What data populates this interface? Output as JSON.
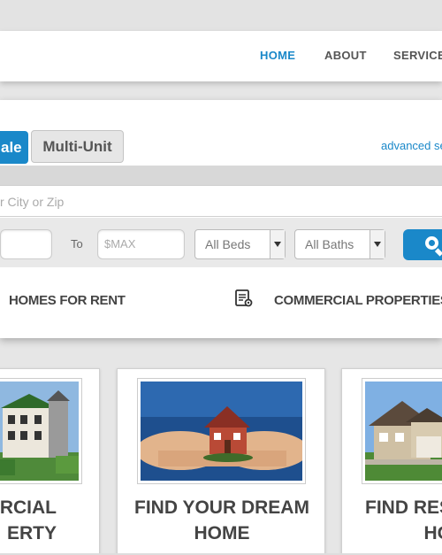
{
  "nav": {
    "items": [
      {
        "label": "HOME",
        "active": true
      },
      {
        "label": "ABOUT",
        "active": false
      },
      {
        "label": "SERVICES",
        "active": false
      }
    ]
  },
  "search": {
    "tabs": [
      {
        "label": "ale",
        "active": true
      },
      {
        "label": "Multi-Unit",
        "active": false
      }
    ],
    "advanced_link": "advanced se",
    "location_placeholder": "r City or Zip",
    "price_min_value": "",
    "to_label": "To",
    "price_max_placeholder": "$MAX",
    "beds_selected": "All Beds",
    "baths_selected": "All Baths",
    "search_button_icon": "search-icon"
  },
  "quick_links": [
    {
      "label": "HOMES FOR RENT"
    },
    {
      "label": "COMMERCIAL PROPERTIES",
      "icon": "document-search-icon"
    }
  ],
  "cards": [
    {
      "title_line1": "ERCIAL",
      "title_line2": "ERTY",
      "image": "apartment-building-photo"
    },
    {
      "title_line1": "FIND YOUR DREAM",
      "title_line2": "HOME",
      "image": "house-in-hands-photo"
    },
    {
      "title_line1": "FIND RES",
      "title_line2": "HO",
      "image": "suburban-house-photo"
    }
  ],
  "colors": {
    "accent": "#1a88c9",
    "nav_text": "#555555",
    "heading_text": "#444444",
    "background": "#e6e6e6"
  }
}
